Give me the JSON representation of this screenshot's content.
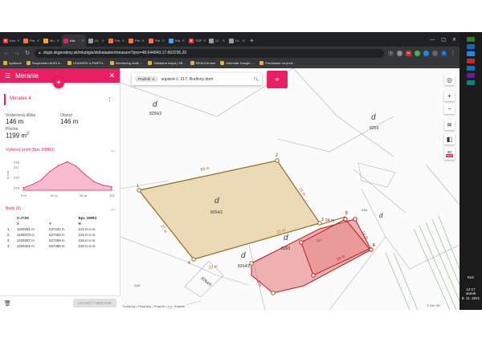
{
  "browser": {
    "tabs": [
      {
        "label": "Kon",
        "fav_color": "#e53935",
        "fav_char": "R"
      },
      {
        "label": "Pre",
        "fav_color": "#ff7043",
        "fav_char": ""
      },
      {
        "label": "Mo",
        "fav_color": "#f9a825",
        "fav_char": ""
      },
      {
        "label": "Kat",
        "fav_color": "#e91e63",
        "fav_char": "",
        "active": true
      },
      {
        "label": "LV",
        "fav_color": "#9e9e9e",
        "fav_char": ""
      },
      {
        "label": "Pre",
        "fav_color": "#ff7043",
        "fav_char": ""
      },
      {
        "label": "Pre",
        "fav_color": "#ff7043",
        "fav_char": ""
      },
      {
        "label": "Pre",
        "fav_color": "#ff7043",
        "fav_char": ""
      },
      {
        "label": "Kat",
        "fav_color": "#42a5f5",
        "fav_char": ""
      },
      {
        "label": "TOP",
        "fav_color": "#e53935",
        "fav_char": "R"
      },
      {
        "label": "LV",
        "fav_color": "#9e9e9e",
        "fav_char": ""
      },
      {
        "label": "LV",
        "fav_color": "#9e9e9e",
        "fav_char": ""
      }
    ],
    "url": "zbgis.skgeodesy.sk/mkzbgis/sk/kataster/measure?pos=48.644943,17.662236,20",
    "bookmarks": [
      "Aplikácie",
      "Rozpredam AUDI A...",
      "LEADERS & PARTN...",
      "Monitoring realit -...",
      "Základná mapa | ZB...",
      "REALVIA web",
      "Kalendár Google -...",
      "Ponúkame na pred..."
    ],
    "extension_badge": "34"
  },
  "panel": {
    "title": "Meranie",
    "measure_name": "Meranie 4",
    "metrics": [
      {
        "label": "Vodorovná dĺžka",
        "value": "146 m"
      },
      {
        "label": "Obvod",
        "value": "146 m"
      },
      {
        "label": "Plocha",
        "value": "1199 m"
      }
    ],
    "area_exp": "2",
    "profile_title": "Výškový profil (Bpv, DMR3)",
    "profile_ylabel": "m n.m.",
    "profile_yticks": [
      "218",
      "217",
      "215",
      "213"
    ],
    "profile_xticks": [
      "0 m",
      "41 m",
      "81 m",
      "122 m"
    ],
    "profile_values": [
      213,
      213.6,
      214.5,
      216.2,
      217.4,
      218.1,
      217.2,
      215.6,
      214.2,
      213.5,
      213.2
    ],
    "points_title": "Body (6)",
    "table_headers": [
      "",
      "S-JTSK",
      "",
      "Bpv, DMR3"
    ],
    "table_subheaders": [
      "",
      "X",
      "Y",
      "H"
    ],
    "rows": [
      [
        "1.",
        "1229391 m",
        "527442 m",
        "213 m n.m."
      ],
      [
        "2.",
        "1229370 m",
        "527453 m",
        "215 m n.m."
      ],
      [
        "3.",
        "1229387 m",
        "527498 m",
        "219 m n.m."
      ],
      [
        "4.",
        "1229401 m",
        "527488 m",
        "218 m n.m."
      ]
    ],
    "finish_label": "UKONČIŤ MERANIE"
  },
  "map": {
    "chip_label": "Prašník",
    "query": "súpisné č. 217, Rodinný dom",
    "parcels": [
      {
        "id": "8256/2"
      },
      {
        "id": "8259"
      },
      {
        "id": "8264/1"
      },
      {
        "id": "8263"
      },
      {
        "id": "8264/2"
      },
      {
        "id": "8264/5"
      },
      {
        "id": "218"
      },
      {
        "id": "217"
      },
      {
        "id": "216"
      }
    ],
    "segment_labels": [
      "69 m",
      "24 m",
      "27 m",
      "21 m",
      "24 m",
      "19 m",
      "14 m",
      "23 m",
      "3 m"
    ],
    "vertex_labels": [
      "1",
      "2",
      "3",
      "4",
      "5",
      "6"
    ],
    "attribution": "Tvrdánky • Prešťany • Prašník • k.ú. Prašník",
    "copyright": "© MV SR",
    "dimension_label": "3D",
    "dimension_badge": "TEST"
  },
  "taskbar": {
    "language": "SLK",
    "time": "12:17",
    "day": "utorok",
    "date": "9. 11. 2021"
  },
  "colors": {
    "accent": "#e91e63",
    "parcel_tan": "#e8d4a8",
    "parcel_red": "#e57373",
    "measure_line": "#8c6d1f",
    "measure_red": "#b71c1c"
  }
}
